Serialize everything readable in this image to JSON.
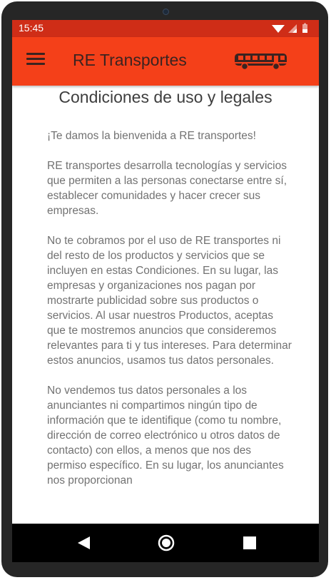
{
  "status_bar": {
    "time": "15:45",
    "icons": [
      "wifi-icon",
      "signal-icon",
      "battery-icon"
    ]
  },
  "app_bar": {
    "title": "RE Transportes",
    "menu_icon": "hamburger-menu-icon",
    "logo_icon": "bus-icon"
  },
  "page": {
    "title": "Condiciones de uso y legales",
    "paragraphs": [
      "¡Te damos la bienvenida a RE transportes!",
      "RE transportes desarrolla tecnologías y servicios que permiten a las personas conectarse entre sí, establecer comunidades y hacer crecer sus empresas.",
      "No te cobramos por el uso de RE transportes ni del resto de los productos y servicios que se incluyen en estas Condiciones. En su lugar, las empresas y organizaciones nos pagan por mostrarte publicidad sobre sus productos o servicios. Al usar nuestros Productos, aceptas que te mostremos anuncios que consideremos relevantes para ti y tus intereses. Para determinar estos anuncios, usamos tus datos personales.",
      "No vendemos tus datos personales a los anunciantes ni compartimos ningún tipo de información que te identifique (como tu nombre, dirección de correo electrónico u otros datos de contacto) con ellos, a menos que nos des permiso específico. En su lugar, los anunciantes nos proporcionan"
    ]
  },
  "nav_bar": {
    "buttons": [
      "back-icon",
      "home-icon",
      "recents-icon"
    ]
  },
  "colors": {
    "status_bar": "#cf2d17",
    "app_bar": "#f44019",
    "app_bar_text": "#3b2320",
    "title_text": "#3e3e3e",
    "body_text": "#727272",
    "device_frame": "#262626",
    "nav_bar": "#000000"
  }
}
